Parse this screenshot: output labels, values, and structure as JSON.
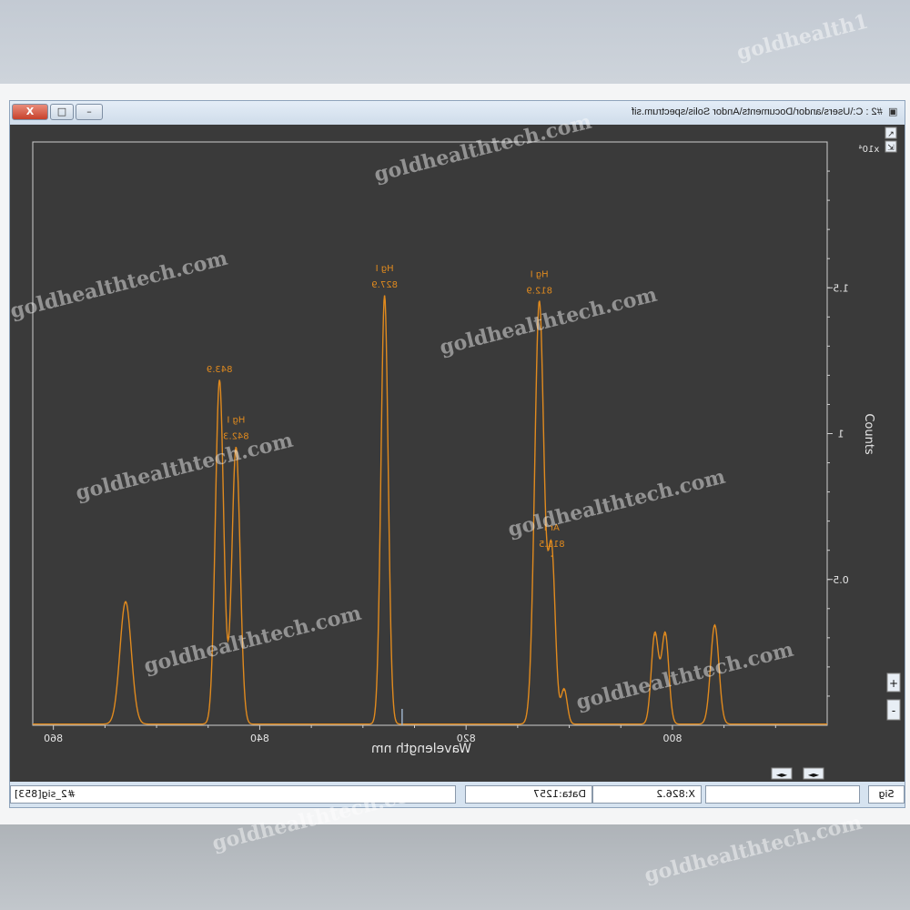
{
  "window": {
    "title": "#2 : C:\\Users\\andor\\Documents\\Andor Solis\\spectrum.sif",
    "close_label": "X",
    "max_label": "□",
    "min_label": "–"
  },
  "statusbar": {
    "signal_label": "#2_sig[853]",
    "data_label": "Data:1257",
    "x_label": "X:826.2",
    "tab_label": "Sig"
  },
  "side_controls": {
    "top_icon_1": "↗",
    "top_icon_2": "⇲",
    "zoom_in": "+",
    "zoom_out": "-",
    "nav": "◄►"
  },
  "watermark": {
    "text": "goldhealthtech.com",
    "top_text": "goldhealth1"
  },
  "colors": {
    "trace": "#e08a1e",
    "plot_bg": "#3a3a3a",
    "axis": "#cfcfcf",
    "label": "#e08a1e"
  },
  "chart_data": {
    "type": "line",
    "mirrored": true,
    "xlabel": "Wavelength nm",
    "ylabel": "Counts",
    "y_multiplier": "x10⁴",
    "xlim": [
      785,
      862
    ],
    "ylim": [
      0,
      2.0
    ],
    "x_ticks": [
      860,
      840,
      820,
      800
    ],
    "y_ticks": [
      "0.5",
      "1",
      "1.5"
    ],
    "y_tick_values": [
      0.5,
      1.0,
      1.5
    ],
    "series": [
      {
        "peaks": [
          {
            "x": 853.0,
            "y": 0.42,
            "w": 0.55
          },
          {
            "x": 843.9,
            "y": 1.18,
            "w": 0.4
          },
          {
            "x": 842.3,
            "y": 0.95,
            "w": 0.4
          },
          {
            "x": 827.9,
            "y": 1.47,
            "w": 0.35
          },
          {
            "x": 812.9,
            "y": 1.45,
            "w": 0.45
          },
          {
            "x": 811.7,
            "y": 0.58,
            "w": 0.35
          },
          {
            "x": 810.5,
            "y": 0.12,
            "w": 0.3
          },
          {
            "x": 801.7,
            "y": 0.31,
            "w": 0.35
          },
          {
            "x": 800.7,
            "y": 0.31,
            "w": 0.35
          },
          {
            "x": 795.9,
            "y": 0.34,
            "w": 0.4
          }
        ]
      }
    ],
    "annotations": [
      {
        "x": 843.9,
        "y": 1.18,
        "lines": [
          "843.9"
        ]
      },
      {
        "x": 842.3,
        "y": 0.95,
        "lines": [
          "Hg I",
          "842.3"
        ]
      },
      {
        "x": 827.9,
        "y": 1.47,
        "lines": [
          "Hg I",
          "827.9"
        ]
      },
      {
        "x": 812.9,
        "y": 1.45,
        "lines": [
          "Hg I",
          "812.9"
        ]
      },
      {
        "x": 811.7,
        "y": 0.58,
        "lines": [
          "Ar I",
          "811.5"
        ]
      }
    ]
  }
}
